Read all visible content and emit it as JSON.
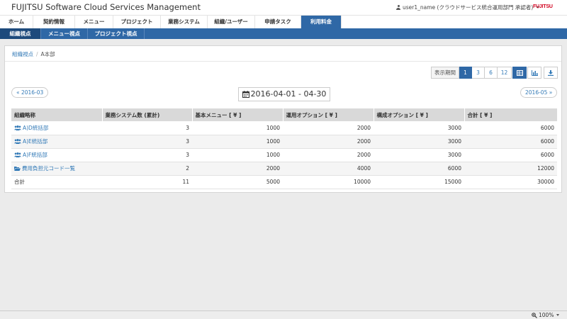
{
  "app": {
    "title": "FUJITSU Software Cloud Services Management",
    "user_label": "user1_name (クラウドサービス統合運用部門 承認者)",
    "logo_text": "FUJITSU"
  },
  "main_nav": [
    {
      "label": "ホーム",
      "active": false
    },
    {
      "label": "契約情報",
      "active": false
    },
    {
      "label": "メニュー",
      "active": false
    },
    {
      "label": "プロジェクト",
      "active": false
    },
    {
      "label": "業務システム",
      "active": false
    },
    {
      "label": "組織/ユーザー",
      "active": false
    },
    {
      "label": "申請タスク",
      "active": false
    },
    {
      "label": "利用料金",
      "active": true
    }
  ],
  "sub_nav": [
    {
      "label": "組織視点",
      "active": true
    },
    {
      "label": "メニュー視点",
      "active": false
    },
    {
      "label": "プロジェクト視点",
      "active": false
    }
  ],
  "breadcrumb": {
    "parent": "組織視点",
    "current": "A本部"
  },
  "toolbar": {
    "period_label": "表示期間",
    "periods": [
      {
        "label": "1",
        "active": true
      },
      {
        "label": "3",
        "active": false
      },
      {
        "label": "6",
        "active": false
      },
      {
        "label": "12",
        "active": false
      }
    ],
    "views": [
      {
        "icon": "table-icon",
        "active": true
      },
      {
        "icon": "bar-chart-icon",
        "active": false
      },
      {
        "icon": "download-icon",
        "active": false
      }
    ]
  },
  "date_nav": {
    "prev": "« 2016-03",
    "range": "2016-04-01 - 04-30",
    "next": "2016-05 »"
  },
  "table": {
    "columns": [
      "組織略称",
      "業務システム数 (累計)",
      "基本メニュー [ ¥ ]",
      "運用オプション [ ¥ ]",
      "構成オプション [ ¥ ]",
      "合計 [ ¥ ]"
    ],
    "rows": [
      {
        "name": "A)D統括部",
        "icon": "users-icon",
        "cells": [
          "3",
          "1000",
          "2000",
          "3000",
          "6000"
        ]
      },
      {
        "name": "A)E統括部",
        "icon": "users-icon",
        "cells": [
          "3",
          "1000",
          "2000",
          "3000",
          "6000"
        ]
      },
      {
        "name": "A)F統括部",
        "icon": "users-icon",
        "cells": [
          "3",
          "1000",
          "2000",
          "3000",
          "6000"
        ]
      },
      {
        "name": "費用負担元コード一覧",
        "icon": "folder-open-icon",
        "cells": [
          "2",
          "2000",
          "4000",
          "6000",
          "12000"
        ]
      }
    ],
    "total": {
      "name": "合計",
      "cells": [
        "11",
        "5000",
        "10000",
        "15000",
        "30000"
      ]
    }
  },
  "status_bar": {
    "zoom": "100%"
  },
  "colors": {
    "primary": "#2f68a6",
    "link": "#337ab7",
    "logo": "#d2001e"
  }
}
